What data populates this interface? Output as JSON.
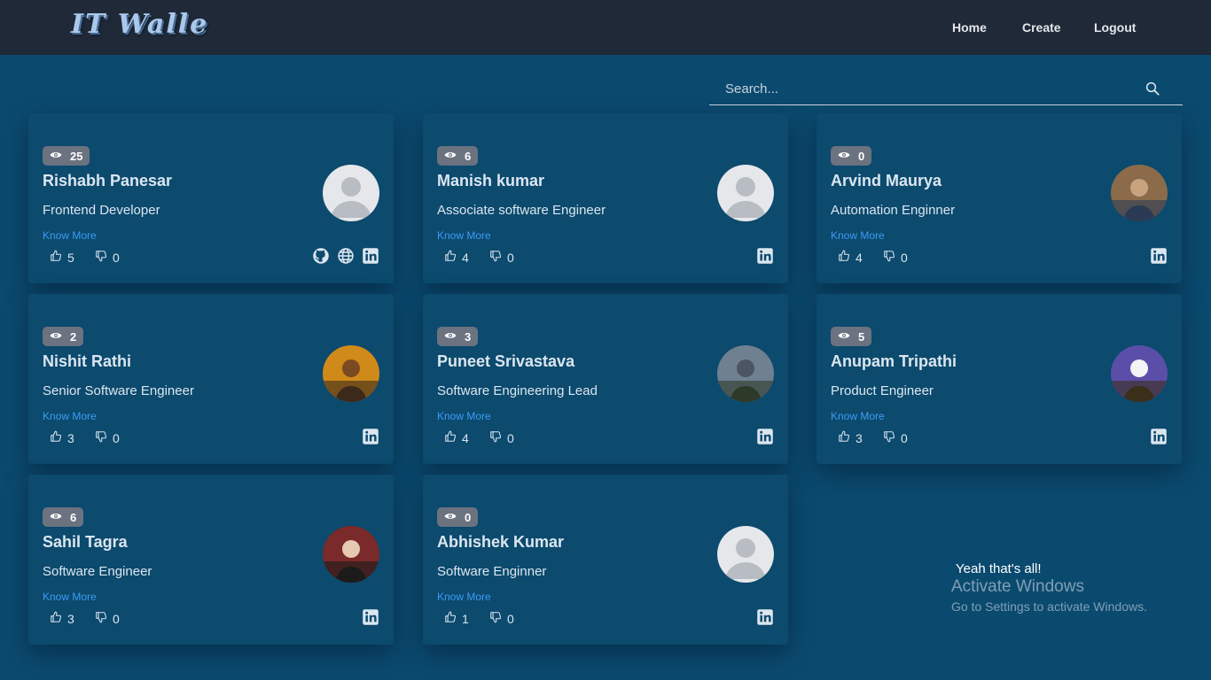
{
  "brand": {
    "logo_text": "IT Walle"
  },
  "nav": {
    "home": "Home",
    "create": "Create",
    "logout": "Logout"
  },
  "search": {
    "placeholder": "Search...",
    "icon": "search-icon"
  },
  "cards": [
    {
      "views": "25",
      "name": "Rishabh Panesar",
      "role": "Frontend Developer",
      "know_more": "Know More",
      "likes": "5",
      "dislikes": "0",
      "avatar": "default-avatar",
      "socials": [
        "github-icon",
        "globe-icon",
        "linkedin-icon"
      ]
    },
    {
      "views": "6",
      "name": "Manish kumar",
      "role": "Associate software Engineer",
      "know_more": "Know More",
      "likes": "4",
      "dislikes": "0",
      "avatar": "default-avatar",
      "socials": [
        "linkedin-icon"
      ]
    },
    {
      "views": "0",
      "name": "Arvind Maurya",
      "role": "Automation Enginner",
      "know_more": "Know More",
      "likes": "4",
      "dislikes": "0",
      "avatar": "photo-avatar",
      "socials": [
        "linkedin-icon"
      ]
    },
    {
      "views": "2",
      "name": "Nishit Rathi",
      "role": "Senior Software Engineer",
      "know_more": "Know More",
      "likes": "3",
      "dislikes": "0",
      "avatar": "photo-avatar",
      "socials": [
        "linkedin-icon"
      ]
    },
    {
      "views": "3",
      "name": "Puneet Srivastava",
      "role": "Software Engineering Lead",
      "know_more": "Know More",
      "likes": "4",
      "dislikes": "0",
      "avatar": "photo-avatar",
      "socials": [
        "linkedin-icon"
      ]
    },
    {
      "views": "5",
      "name": "Anupam Tripathi",
      "role": "Product Engineer",
      "know_more": "Know More",
      "likes": "3",
      "dislikes": "0",
      "avatar": "photo-avatar",
      "socials": [
        "linkedin-icon"
      ]
    },
    {
      "views": "6",
      "name": "Sahil Tagra",
      "role": "Software Engineer",
      "know_more": "Know More",
      "likes": "3",
      "dislikes": "0",
      "avatar": "photo-avatar",
      "socials": [
        "linkedin-icon"
      ]
    },
    {
      "views": "0",
      "name": "Abhishek Kumar",
      "role": "Software Enginner",
      "know_more": "Know More",
      "likes": "1",
      "dislikes": "0",
      "avatar": "default-avatar",
      "socials": [
        "linkedin-icon"
      ]
    }
  ],
  "footer": {
    "end_message": "Yeah that's all!"
  },
  "watermark": {
    "title": "Activate Windows",
    "subtitle": "Go to Settings to activate Windows."
  },
  "colors": {
    "page_bg": "#0b4a6f",
    "topbar_bg": "#1f2937",
    "card_bg": "#0c4a6e",
    "link": "#3b9cf5",
    "badge_bg": "#6b7280"
  }
}
